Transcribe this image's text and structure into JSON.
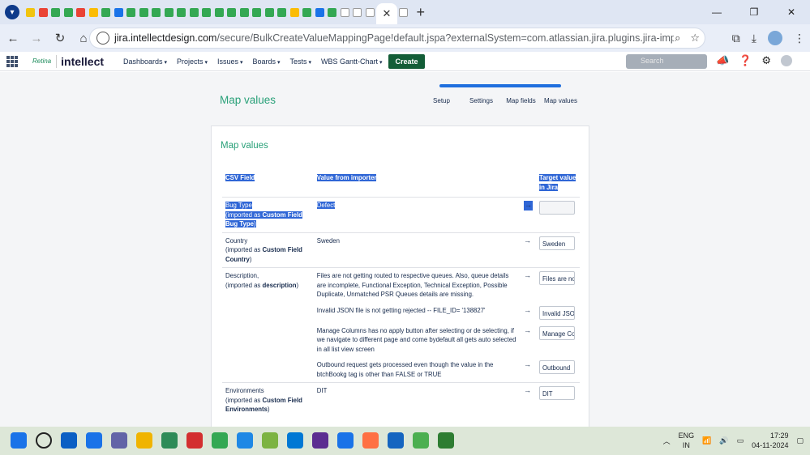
{
  "browser": {
    "tab_count_favicons": 43,
    "new_tab_label": "+",
    "close_tab_label": "✕",
    "url_host": "jira.intellectdesign.com",
    "url_rest": "/secure/BulkCreateValueMappingPage!default.jspa?externalSystem=com.atlassian.jira.plugins.jira-importers-plugin:bulkCreat..."
  },
  "nav": {
    "logo_mark": "Retina",
    "logo_text": "intellect",
    "menus": [
      "Dashboards",
      "Projects",
      "Issues",
      "Boards",
      "Tests",
      "WBS Gantt-Chart"
    ],
    "create_label": "Create",
    "search_placeholder": "Search"
  },
  "page": {
    "title": "Map values",
    "steps": [
      "Setup",
      "Settings",
      "Map fields",
      "Map values"
    ],
    "panel_title": "Map values"
  },
  "table": {
    "headers": [
      "CSV Field",
      "Value from importer",
      "Target value in Jira"
    ],
    "arrow": "→",
    "rows": [
      {
        "field": "Bug Type",
        "imported_prefix": "(imported as ",
        "imported_name": "Custom Field Bug Type",
        "imported_suffix": ")",
        "values": [
          {
            "value": "Defect",
            "target": ""
          }
        ]
      },
      {
        "field": "Country",
        "imported_prefix": "(imported as ",
        "imported_name": "Custom Field Country",
        "imported_suffix": ")",
        "values": [
          {
            "value": "Sweden",
            "target": "Sweden"
          }
        ]
      },
      {
        "field": "Description,",
        "imported_prefix": "(imported as ",
        "imported_name": "description",
        "imported_suffix": ")",
        "values": [
          {
            "value": "Files are not getting routed to respective queues. Also, queue details are incomplete, Functional Exception, Technical Exception, Possible Duplicate, Unmatched PSR Queues details are missing.",
            "target": "Files are not"
          },
          {
            "value": "Invalid JSON file is not getting rejected -- FILE_ID= '138827'",
            "target": "Invalid JSON"
          },
          {
            "value": "Manage Columns has no apply button after selecting or de selecting, if we navigate to different page and come bydefault all gets auto selected in all list view screen",
            "target": "Manage Col"
          },
          {
            "value": "Outbound request gets processed even though the value in the btchBookg tag is other than FALSE or TRUE",
            "target": "Outbound"
          }
        ]
      },
      {
        "field": "Environments",
        "imported_prefix": "(imported as ",
        "imported_name": "Custom Field Environments",
        "imported_suffix": ")",
        "values": [
          {
            "value": "DIT",
            "target": "DIT"
          }
        ]
      }
    ]
  },
  "taskbar": {
    "lang_top": "ENG",
    "lang_bottom": "IN",
    "time": "17:29",
    "date": "04-11-2024"
  }
}
